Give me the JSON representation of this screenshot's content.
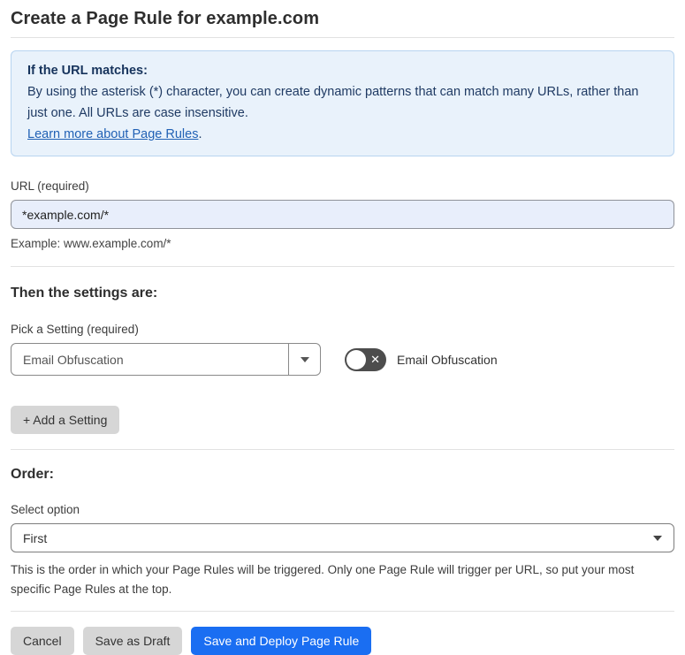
{
  "page": {
    "title": "Create a Page Rule for example.com"
  },
  "info_box": {
    "heading": "If the URL matches:",
    "body": "By using the asterisk (*) character, you can create dynamic patterns that can match many URLs, rather than just one. All URLs are case insensitive.",
    "link_label": "Learn more about Page Rules",
    "link_suffix": "."
  },
  "url_field": {
    "label": "URL (required)",
    "value": "*example.com/*",
    "helper": "Example: www.example.com/*"
  },
  "settings_section": {
    "heading": "Then the settings are:",
    "picker_label": "Pick a Setting (required)",
    "picker_value": "Email Obfuscation",
    "toggle_label": "Email Obfuscation",
    "toggle_state": "off",
    "toggle_off_glyph": "✕",
    "add_setting_label": "+ Add a Setting"
  },
  "order_section": {
    "heading": "Order:",
    "select_label": "Select option",
    "select_value": "First",
    "description": "This is the order in which your Page Rules will be triggered. Only one Page Rule will trigger per URL, so put your most specific Page Rules at the top."
  },
  "footer": {
    "cancel_label": "Cancel",
    "save_draft_label": "Save as Draft",
    "save_deploy_label": "Save and Deploy Page Rule"
  },
  "colors": {
    "primary_button": "#1a6ef2",
    "info_box_bg": "#e9f2fb",
    "info_box_border": "#b8d4f0",
    "info_text": "#1f3a63",
    "link": "#2161b5",
    "url_input_bg": "#e8eefb",
    "gray_button_bg": "#d6d6d6",
    "toggle_bg": "#4d4d4d"
  }
}
